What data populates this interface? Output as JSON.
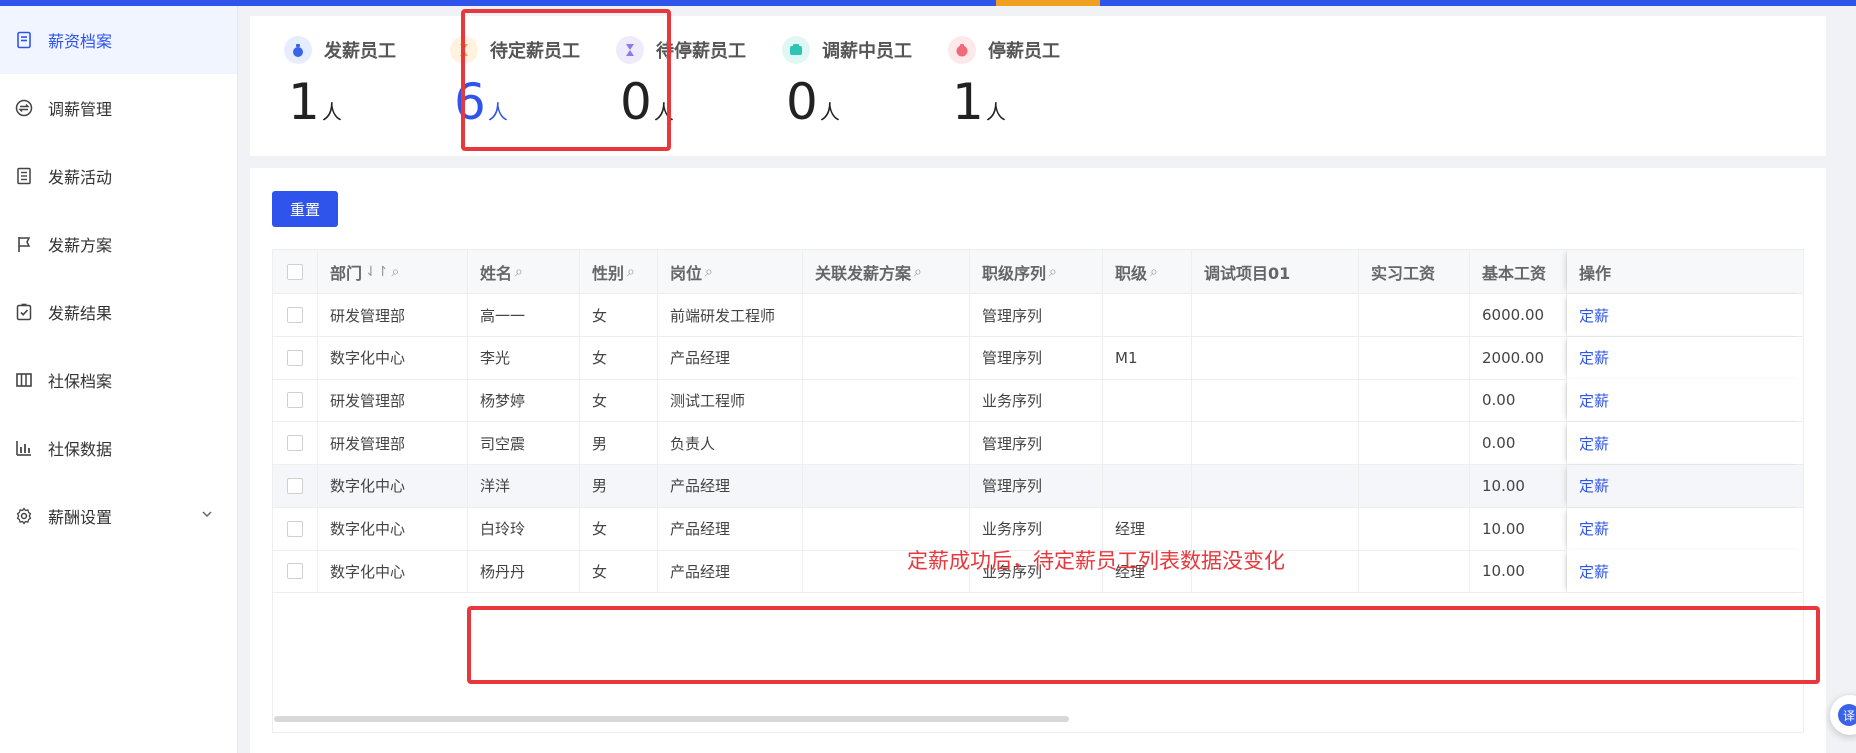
{
  "sidebar": {
    "items": [
      {
        "label": "薪资档案",
        "icon": "document-icon"
      },
      {
        "label": "调薪管理",
        "icon": "exchange-icon"
      },
      {
        "label": "发薪活动",
        "icon": "list-icon"
      },
      {
        "label": "发薪方案",
        "icon": "flag-icon"
      },
      {
        "label": "发薪结果",
        "icon": "check-clipboard-icon"
      },
      {
        "label": "社保档案",
        "icon": "grid-icon"
      },
      {
        "label": "社保数据",
        "icon": "bar-chart-icon"
      },
      {
        "label": "薪酬设置",
        "icon": "gear-icon"
      }
    ]
  },
  "stats": [
    {
      "label": "发薪员工",
      "value": "1",
      "unit": "人",
      "color": "#3b63e8"
    },
    {
      "label": "待定薪员工",
      "value": "6",
      "unit": "人",
      "color": "#f5a623"
    },
    {
      "label": "待停薪员工",
      "value": "0",
      "unit": "人",
      "color": "#8f7ae8"
    },
    {
      "label": "调薪中员工",
      "value": "0",
      "unit": "人",
      "color": "#2ec4b6"
    },
    {
      "label": "停薪员工",
      "value": "1",
      "unit": "人",
      "color": "#f06a7a"
    }
  ],
  "toolbar": {
    "reset_label": "重置"
  },
  "table": {
    "columns": [
      "部门",
      "姓名",
      "性别",
      "岗位",
      "关联发薪方案",
      "职级序列",
      "职级",
      "调试项目01",
      "实习工资",
      "基本工资",
      "操作"
    ],
    "action_label": "定薪",
    "rows": [
      {
        "dept": "研发管理部",
        "name": "高一一",
        "gender": "女",
        "post": "前端研发工程师",
        "scheme": "",
        "seq": "管理序列",
        "level": "",
        "debug": "",
        "intern": "",
        "base": "6000.00"
      },
      {
        "dept": "数字化中心",
        "name": "李光",
        "gender": "女",
        "post": "产品经理",
        "scheme": "",
        "seq": "管理序列",
        "level": "M1",
        "debug": "",
        "intern": "",
        "base": "2000.00"
      },
      {
        "dept": "研发管理部",
        "name": "杨梦婷",
        "gender": "女",
        "post": "测试工程师",
        "scheme": "",
        "seq": "业务序列",
        "level": "",
        "debug": "",
        "intern": "",
        "base": "0.00"
      },
      {
        "dept": "研发管理部",
        "name": "司空震",
        "gender": "男",
        "post": "负责人",
        "scheme": "",
        "seq": "管理序列",
        "level": "",
        "debug": "",
        "intern": "",
        "base": "0.00"
      },
      {
        "dept": "数字化中心",
        "name": "洋洋",
        "gender": "男",
        "post": "产品经理",
        "scheme": "",
        "seq": "管理序列",
        "level": "",
        "debug": "",
        "intern": "",
        "base": "10.00"
      },
      {
        "dept": "数字化中心",
        "name": "白玲玲",
        "gender": "女",
        "post": "产品经理",
        "scheme": "",
        "seq": "业务序列",
        "level": "经理",
        "debug": "",
        "intern": "",
        "base": "10.00"
      },
      {
        "dept": "数字化中心",
        "name": "杨丹丹",
        "gender": "女",
        "post": "产品经理",
        "scheme": "",
        "seq": "业务序列",
        "level": "经理",
        "debug": "",
        "intern": "",
        "base": "10.00"
      }
    ]
  },
  "annotation": {
    "text": "定薪成功后，待定薪员工列表数据没变化",
    "color": "#e8383d"
  },
  "translate": {
    "label": "译"
  }
}
